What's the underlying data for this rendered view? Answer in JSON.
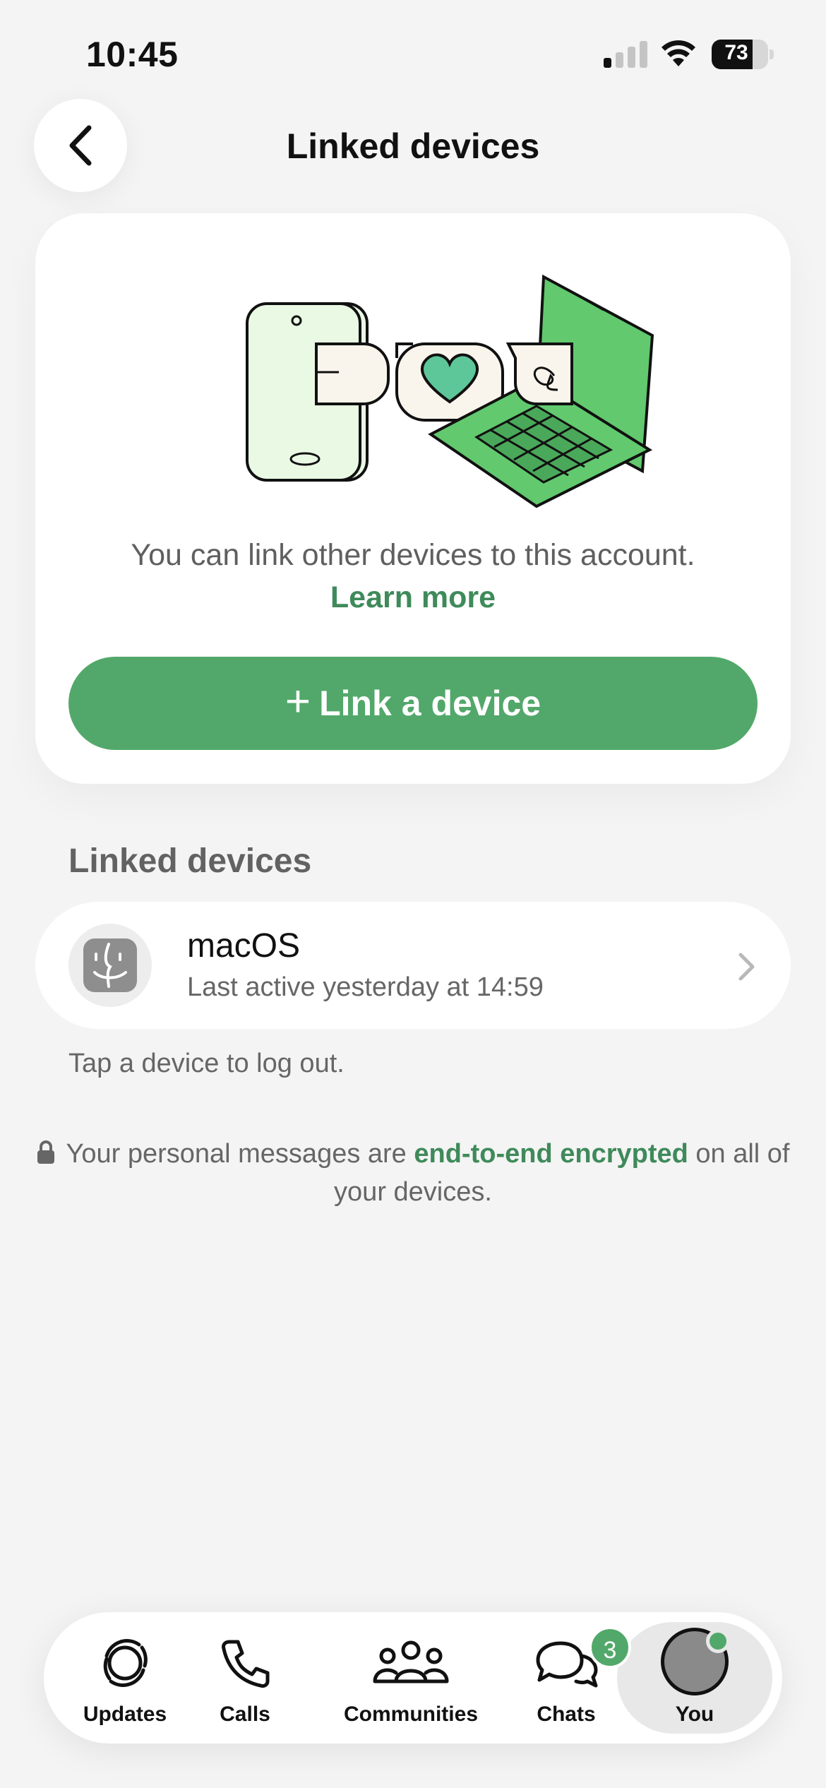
{
  "status_bar": {
    "time": "10:45",
    "battery_percent": "73",
    "battery_level": 0.73,
    "signal_bars_active": 1,
    "signal_bars_total": 4,
    "icons": [
      "cellular-signal-icon",
      "wifi-icon",
      "battery-icon"
    ]
  },
  "header": {
    "title": "Linked devices",
    "back_icon": "chevron-left-icon"
  },
  "hero": {
    "illustration": "phone-chat-laptop-illustration",
    "description": "You can link other devices to this account.",
    "learn_more": "Learn more",
    "link_button_icon": "+",
    "link_button_label": "Link a device"
  },
  "linked_devices": {
    "section_title": "Linked devices",
    "devices": [
      {
        "name": "macOS",
        "last_active": "Last active yesterday at 14:59",
        "icon": "macos-finder-icon"
      }
    ],
    "hint": "Tap a device to log out."
  },
  "encryption": {
    "prefix": "Your personal messages are ",
    "link": "end-to-end encrypted",
    "suffix": " on all of your devices.",
    "icon": "lock-icon"
  },
  "tab_bar": {
    "tabs": [
      {
        "label": "Updates",
        "icon": "updates-icon"
      },
      {
        "label": "Calls",
        "icon": "phone-icon"
      },
      {
        "label": "Communities",
        "icon": "communities-icon"
      },
      {
        "label": "Chats",
        "icon": "chats-icon",
        "badge": "3"
      },
      {
        "label": "You",
        "icon": "avatar",
        "selected": true
      }
    ]
  },
  "colors": {
    "accent": "#52a86a",
    "accent_text": "#3f8a5a",
    "background": "#f4f4f4",
    "card": "#ffffff"
  }
}
